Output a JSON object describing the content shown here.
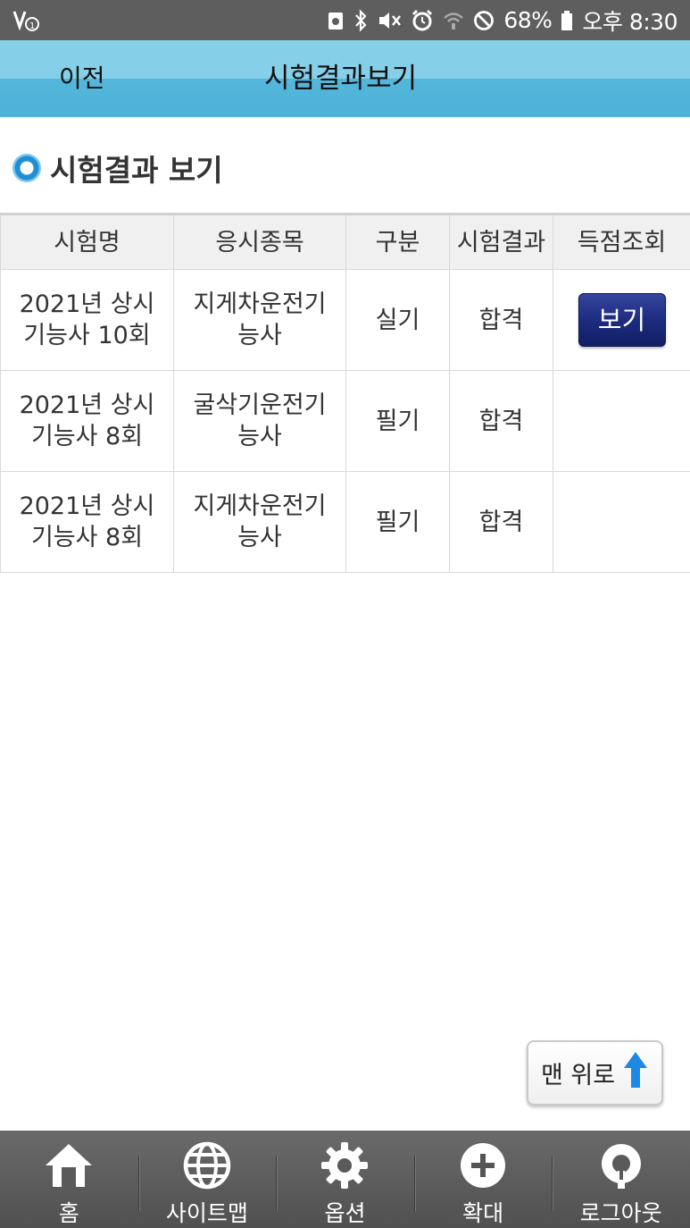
{
  "status_bar": {
    "carrier_icon": "volte-icon",
    "icons": [
      "screenshot-icon",
      "bluetooth-icon",
      "mute-icon",
      "alarm-icon",
      "wifi-icon",
      "blocked-icon"
    ],
    "battery": "68%",
    "time": "오후 8:30"
  },
  "header": {
    "back_label": "이전",
    "title": "시험결과보기"
  },
  "section": {
    "title": "시험결과 보기"
  },
  "table": {
    "columns": [
      "시험명",
      "응시종목",
      "구분",
      "시험결과",
      "득점조회"
    ],
    "rows": [
      {
        "exam": [
          "2021년 상시",
          "기능사 10회"
        ],
        "subject": [
          "지게차운전기",
          "능사"
        ],
        "type": "실기",
        "result": "합격",
        "score_button": "보기"
      },
      {
        "exam": [
          "2021년 상시",
          "기능사 8회"
        ],
        "subject": [
          "굴삭기운전기",
          "능사"
        ],
        "type": "필기",
        "result": "합격",
        "score_button": ""
      },
      {
        "exam": [
          "2021년 상시",
          "기능사 8회"
        ],
        "subject": [
          "지게차운전기",
          "능사"
        ],
        "type": "필기",
        "result": "합격",
        "score_button": ""
      }
    ]
  },
  "to_top": {
    "label": "맨 위로",
    "icon": "arrow-up-icon",
    "icon_color": "#1e88e5"
  },
  "bottom_nav": [
    {
      "label": "홈",
      "icon": "home-icon"
    },
    {
      "label": "사이트맵",
      "icon": "globe-icon"
    },
    {
      "label": "옵션",
      "icon": "gear-icon"
    },
    {
      "label": "확대",
      "icon": "zoom-plus-icon"
    },
    {
      "label": "로그아웃",
      "icon": "logout-icon"
    }
  ],
  "colors": {
    "header_top": "#85cfe8",
    "header_bottom": "#4cb2d8",
    "button_navy": "#1b2a7c",
    "nav_bg": "#5a5a5a"
  }
}
